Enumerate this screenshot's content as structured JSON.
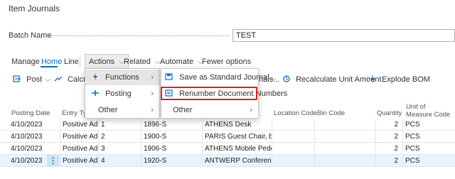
{
  "page": {
    "title": "Item Journals"
  },
  "batch": {
    "label": "Batch Name",
    "value": "TEST"
  },
  "menu": {
    "manage": "Manage",
    "home": "Home",
    "line": "Line",
    "actions": "Actions",
    "related": "Related",
    "automate": "Automate",
    "fewer": "Fewer options"
  },
  "toolbar": {
    "post": "Post",
    "calculate": "Calculat",
    "journals_suffix": "nals...",
    "recalc": "Recalculate Unit Amount",
    "explode": "Explode BOM"
  },
  "actions_menu": {
    "functions": "Functions",
    "posting": "Posting",
    "other": "Other"
  },
  "functions_menu": {
    "save_standard": "Save as Standard Journal...",
    "renumber": "Renumber Document Numbers",
    "other": "Other"
  },
  "columns": {
    "posting_date": "Posting Date",
    "entry_type": "Entry Type",
    "location_code": "Location Code",
    "bin_code": "Bin Code",
    "quantity": "Quantity",
    "uom_line1": "Unit of",
    "uom_line2": "Measure Code"
  },
  "rows": [
    {
      "date": "4/10/2023",
      "entry": "Positive Ad...",
      "doc": "1",
      "item": "1896-S",
      "desc": "ATHENS Desk",
      "qty": "2",
      "uom": "PCS"
    },
    {
      "date": "4/10/2023",
      "entry": "Positive Ad...",
      "doc": "2",
      "item": "1900-S",
      "desc": "PARIS Guest Chair, black",
      "qty": "2",
      "uom": "PCS"
    },
    {
      "date": "4/10/2023",
      "entry": "Positive Ad...",
      "doc": "3",
      "item": "1906-S",
      "desc": "ATHENS Mobile Pedestal",
      "qty": "2",
      "uom": "PCS"
    },
    {
      "date": "4/10/2023",
      "entry": "Positive Ad...",
      "doc": "4",
      "item": "1920-S",
      "desc": "ANTWERP Conference Table",
      "qty": "2",
      "uom": "PCS"
    }
  ],
  "colors": {
    "accent": "#0f6cbd",
    "highlight": "#e02020",
    "selected_row": "#e9f3fb"
  },
  "icons": [
    "post-icon",
    "chevron-down-icon",
    "lightning-icon",
    "posting-icon",
    "save-journal-icon",
    "renumber-icon",
    "recalculate-icon",
    "explode-bom-icon",
    "chevron-right-icon",
    "row-menu-icon"
  ]
}
